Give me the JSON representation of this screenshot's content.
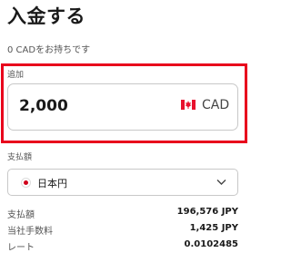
{
  "header": {
    "title": "入金する"
  },
  "balance": {
    "text": "0 CADをお持ちです"
  },
  "add": {
    "label": "追加",
    "amount": "2,000",
    "currency": "CAD",
    "flag_icon": "canada-flag-icon"
  },
  "payment": {
    "label": "支払額",
    "selected": "日本円",
    "flag_icon": "japan-flag-icon"
  },
  "summary": [
    {
      "label": "支払額",
      "value": "196,576 JPY"
    },
    {
      "label": "当社手数料",
      "value": "1,425 JPY"
    },
    {
      "label": "レート",
      "value": "0.0102485"
    }
  ],
  "colors": {
    "highlight": "#e8001c",
    "canada_red": "#e8112d",
    "japan_red": "#d0021b"
  }
}
